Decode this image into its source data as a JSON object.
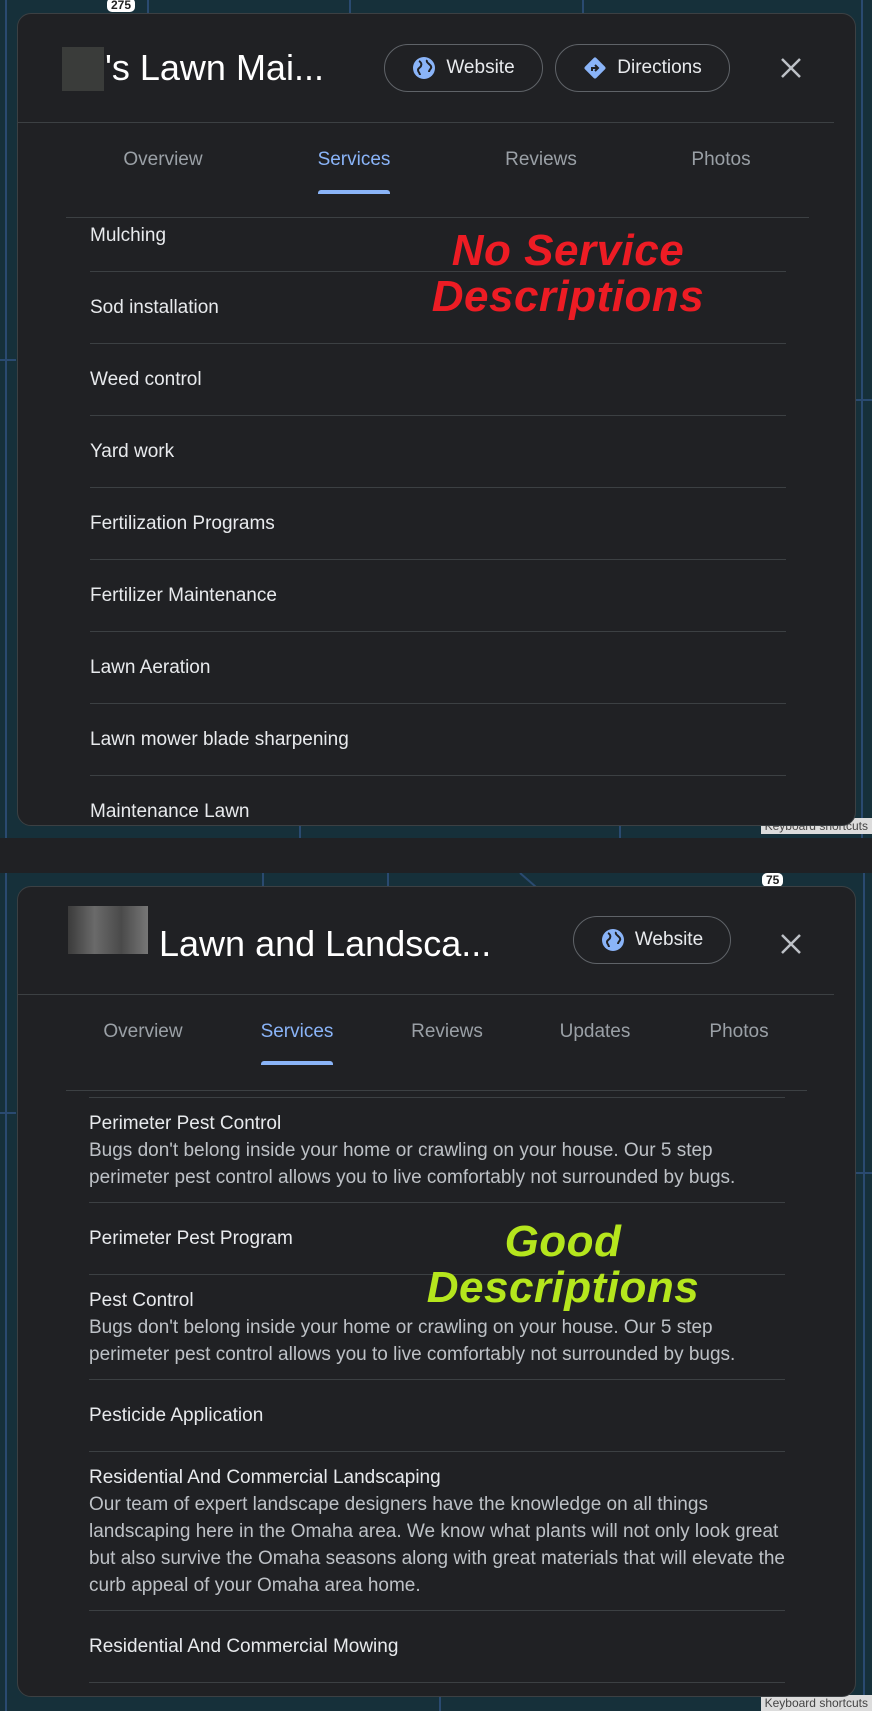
{
  "colors": {
    "accent": "#8ab4f8",
    "no_desc_annotation": "#ed1c24",
    "good_desc_annotation": "#b5e61d",
    "panel_bg": "#202124",
    "map_bg": "#16303a"
  },
  "map_top": {
    "shield": "275",
    "keyboard_shortcuts": "Keyboard shortcuts"
  },
  "map_bottom": {
    "shield": "75",
    "keyboard_shortcuts": "Keyboard shortcuts"
  },
  "panel1": {
    "title": "'s Lawn Mai...",
    "website_label": "Website",
    "website_icon": "globe-icon",
    "directions_label": "Directions",
    "directions_icon": "directions-icon",
    "close_icon": "close-icon",
    "tabs": [
      {
        "label": "Overview"
      },
      {
        "label": "Services",
        "active": true
      },
      {
        "label": "Reviews"
      },
      {
        "label": "Photos"
      }
    ],
    "services": [
      {
        "name": "Mulching"
      },
      {
        "name": "Sod installation"
      },
      {
        "name": "Weed control"
      },
      {
        "name": "Yard work"
      },
      {
        "name": "Fertilization Programs"
      },
      {
        "name": "Fertilizer Maintenance"
      },
      {
        "name": "Lawn Aeration"
      },
      {
        "name": "Lawn mower blade sharpening"
      },
      {
        "name": "Maintenance Lawn"
      }
    ],
    "annotation": {
      "line1": "No Service",
      "line2": "Descriptions"
    }
  },
  "panel2": {
    "title": "Lawn and Landsca...",
    "website_label": "Website",
    "website_icon": "globe-icon",
    "close_icon": "close-icon",
    "tabs": [
      {
        "label": "Overview"
      },
      {
        "label": "Services",
        "active": true
      },
      {
        "label": "Reviews"
      },
      {
        "label": "Updates"
      },
      {
        "label": "Photos"
      }
    ],
    "services": [
      {
        "name": "Perimeter Pest Control",
        "description": "Bugs don't belong inside your home or crawling on your house. Our 5 step perimeter pest control allows you to live comfortably not surrounded by bugs."
      },
      {
        "name": "Perimeter Pest Program"
      },
      {
        "name": "Pest Control",
        "description": "Bugs don't belong inside your home or crawling on your house. Our 5 step perimeter pest control allows you to live comfortably not surrounded by bugs."
      },
      {
        "name": "Pesticide Application"
      },
      {
        "name": "Residential And Commercial Landscaping",
        "description": "Our team of expert landscape designers have the knowledge on all things landscaping here in the Omaha area. We know what plants will not only look great but also survive the Omaha seasons along with great materials that will elevate the curb appeal of your Omaha area home."
      },
      {
        "name": "Residential And Commercial Mowing"
      }
    ],
    "annotation": {
      "line1": "Good",
      "line2": "Descriptions"
    }
  }
}
